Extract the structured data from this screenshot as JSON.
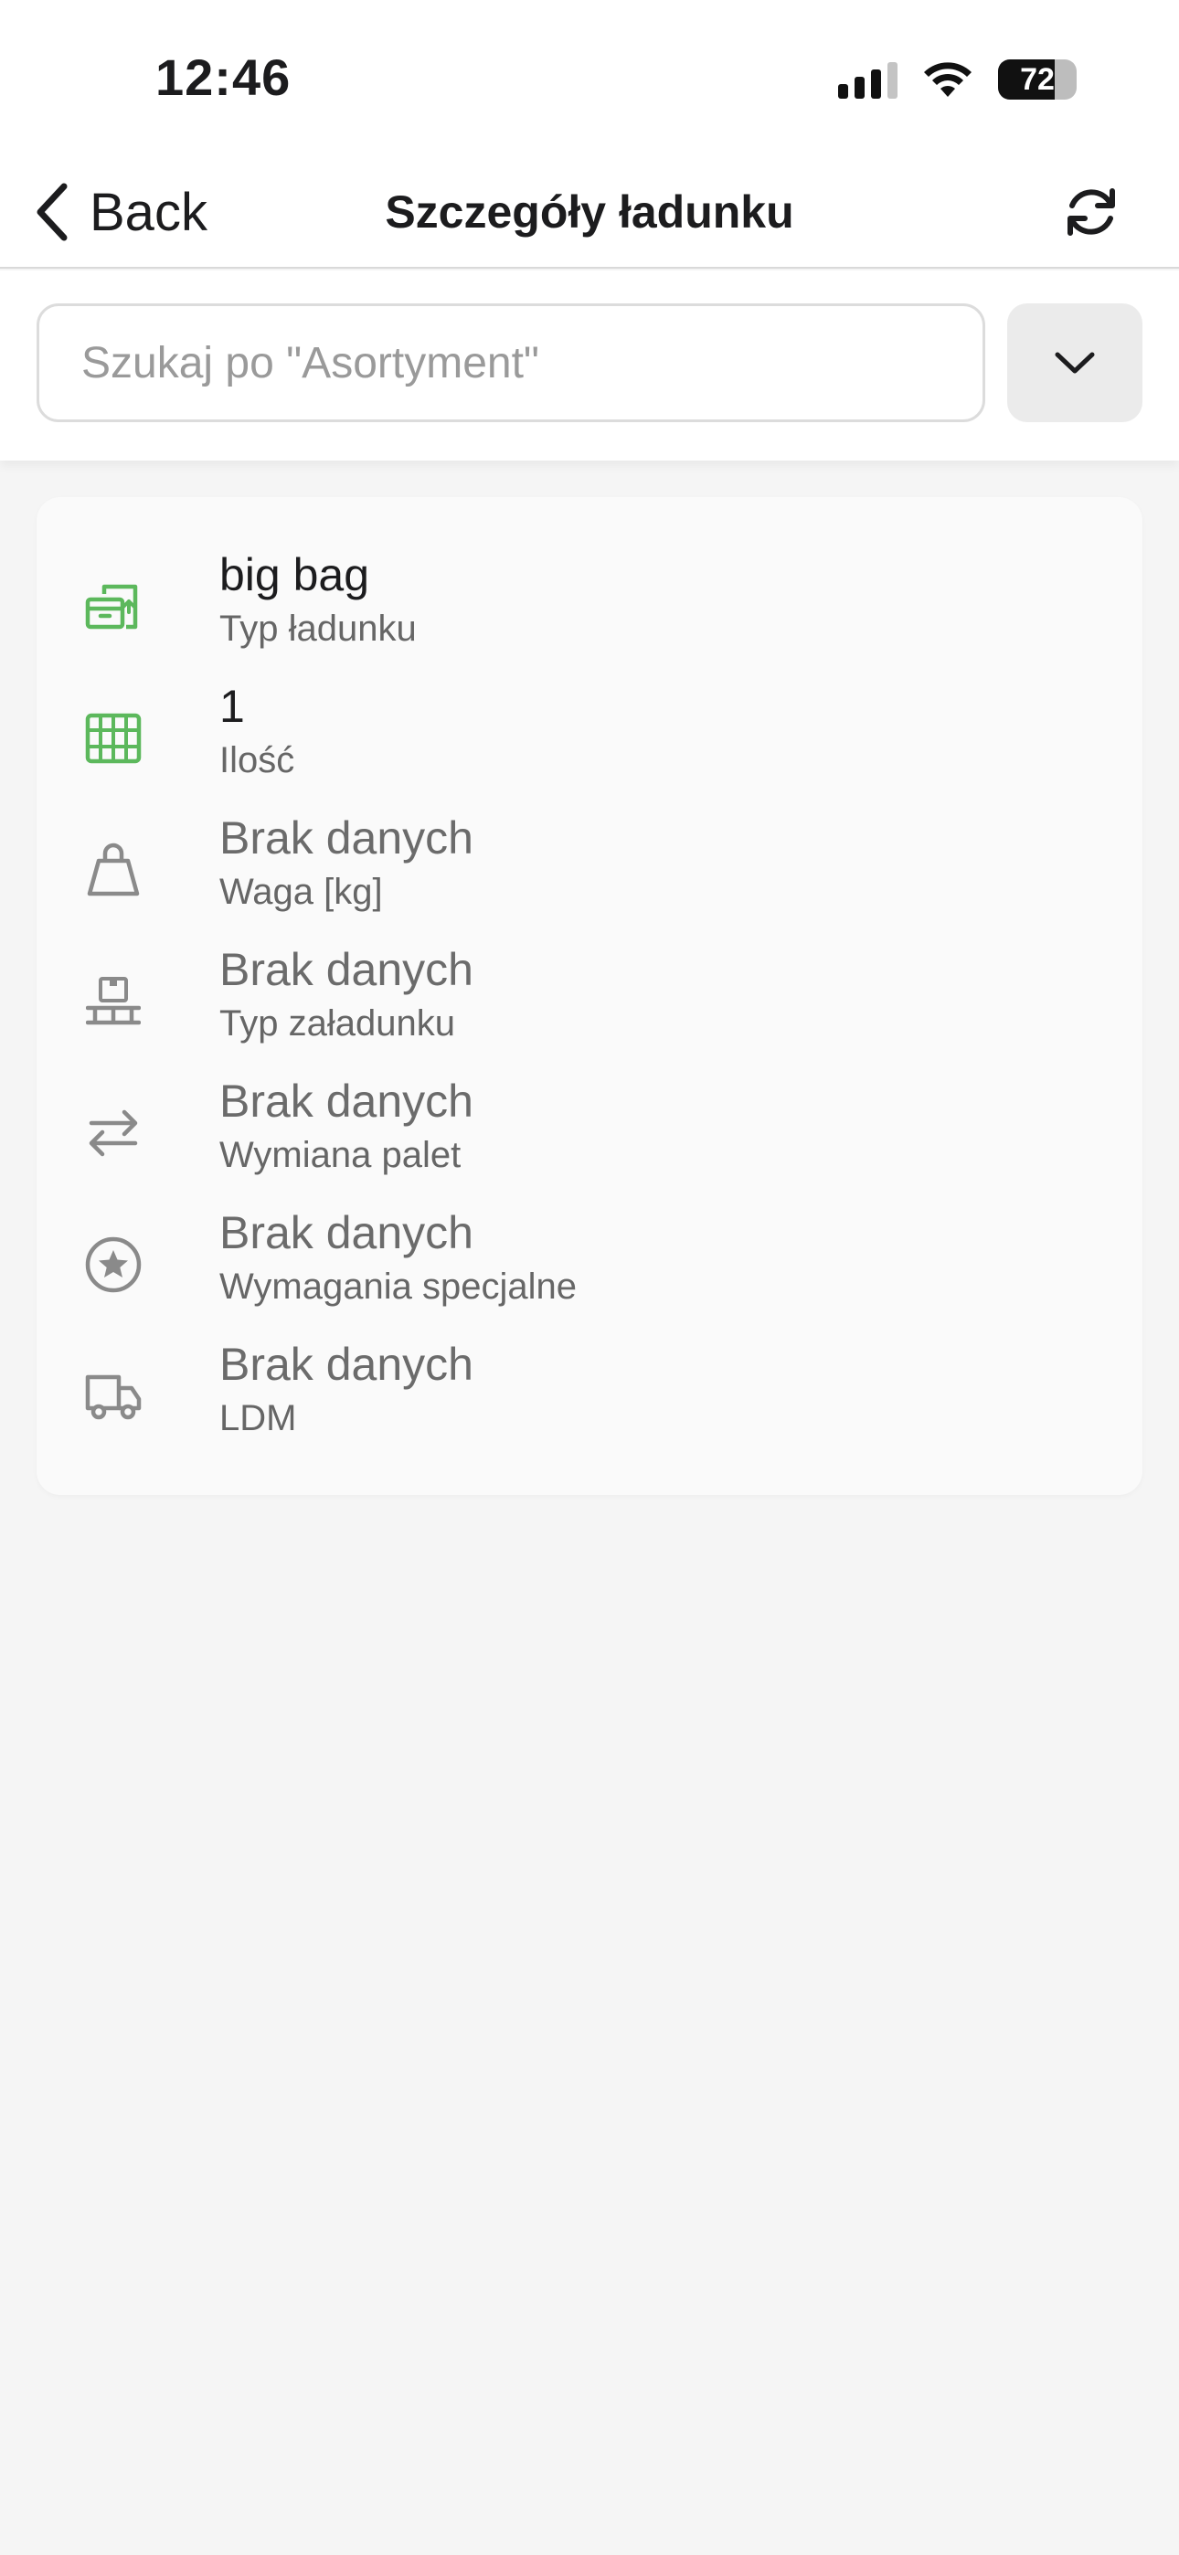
{
  "status_bar": {
    "time": "12:46",
    "battery_level": "72",
    "icons": [
      "signal-icon",
      "wifi-icon",
      "battery-icon"
    ]
  },
  "nav": {
    "back_label": "Back",
    "title": "Szczegóły ładunku",
    "refresh_icon": "refresh-icon"
  },
  "search": {
    "placeholder": "Szukaj po \"Asortyment\"",
    "value": "",
    "dropdown_icon": "chevron-down-icon"
  },
  "details": [
    {
      "value": "big bag",
      "label": "Typ ładunku",
      "icon": "box-upload-icon",
      "has_value": true
    },
    {
      "value": "1",
      "label": "Ilość",
      "icon": "abacus-icon",
      "has_value": true
    },
    {
      "value": "Brak danych",
      "label": "Waga [kg]",
      "icon": "weight-icon",
      "has_value": false
    },
    {
      "value": "Brak danych",
      "label": "Typ załadunku",
      "icon": "pallet-icon",
      "has_value": false
    },
    {
      "value": "Brak danych",
      "label": "Wymiana palet",
      "icon": "exchange-arrows-icon",
      "has_value": false
    },
    {
      "value": "Brak danych",
      "label": "Wymagania specjalne",
      "icon": "star-circle-icon",
      "has_value": false
    },
    {
      "value": "Brak danych",
      "label": "LDM",
      "icon": "truck-icon",
      "has_value": false
    }
  ],
  "colors": {
    "accent_green": "#5cb85c",
    "icon_gray": "#8a8a8a",
    "background": "#f5f5f5",
    "card": "#fafafa"
  }
}
